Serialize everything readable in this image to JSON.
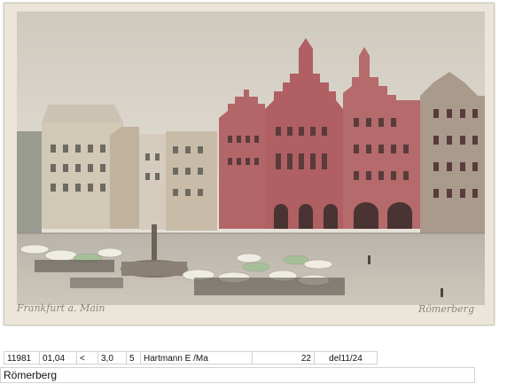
{
  "postcard": {
    "caption_left": "Frankfurt a. Main",
    "caption_right": "Römerberg",
    "image_alt": "Römerberg square with market stalls, fountain and stepped-gable town hall"
  },
  "record": {
    "fields": [
      "11981",
      "01,04",
      "<",
      "3,0",
      "5",
      "Hartmann E /Ma",
      "22",
      "del11/24"
    ],
    "description": "Römerberg"
  },
  "colors": {
    "sky": "#d8d2c6",
    "townhall": "#b5686a",
    "cobble": "#bdb7ab",
    "card": "#ece6da"
  }
}
